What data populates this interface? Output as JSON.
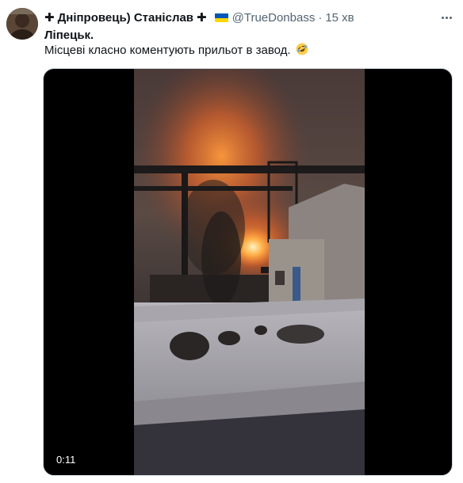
{
  "tweet": {
    "display_name": "Дніпровець) Станіслав",
    "cross_prefix": "✚",
    "cross_suffix": "✚",
    "handle": "@TrueDonbass",
    "separator": "·",
    "time": "15 хв",
    "line1": "Ліпецьк.",
    "line2": "Місцеві класно коментують прильот в завод.",
    "emoji": "rolling-on-floor-laughing-emoji",
    "more_icon": "ellipsis-icon"
  },
  "media": {
    "type": "video",
    "duration": "0:11"
  },
  "colors": {
    "text": "#0f1419",
    "secondary": "#536471",
    "flag_blue": "#0057b7",
    "flag_yellow": "#ffd700",
    "border": "#cfd9de"
  }
}
